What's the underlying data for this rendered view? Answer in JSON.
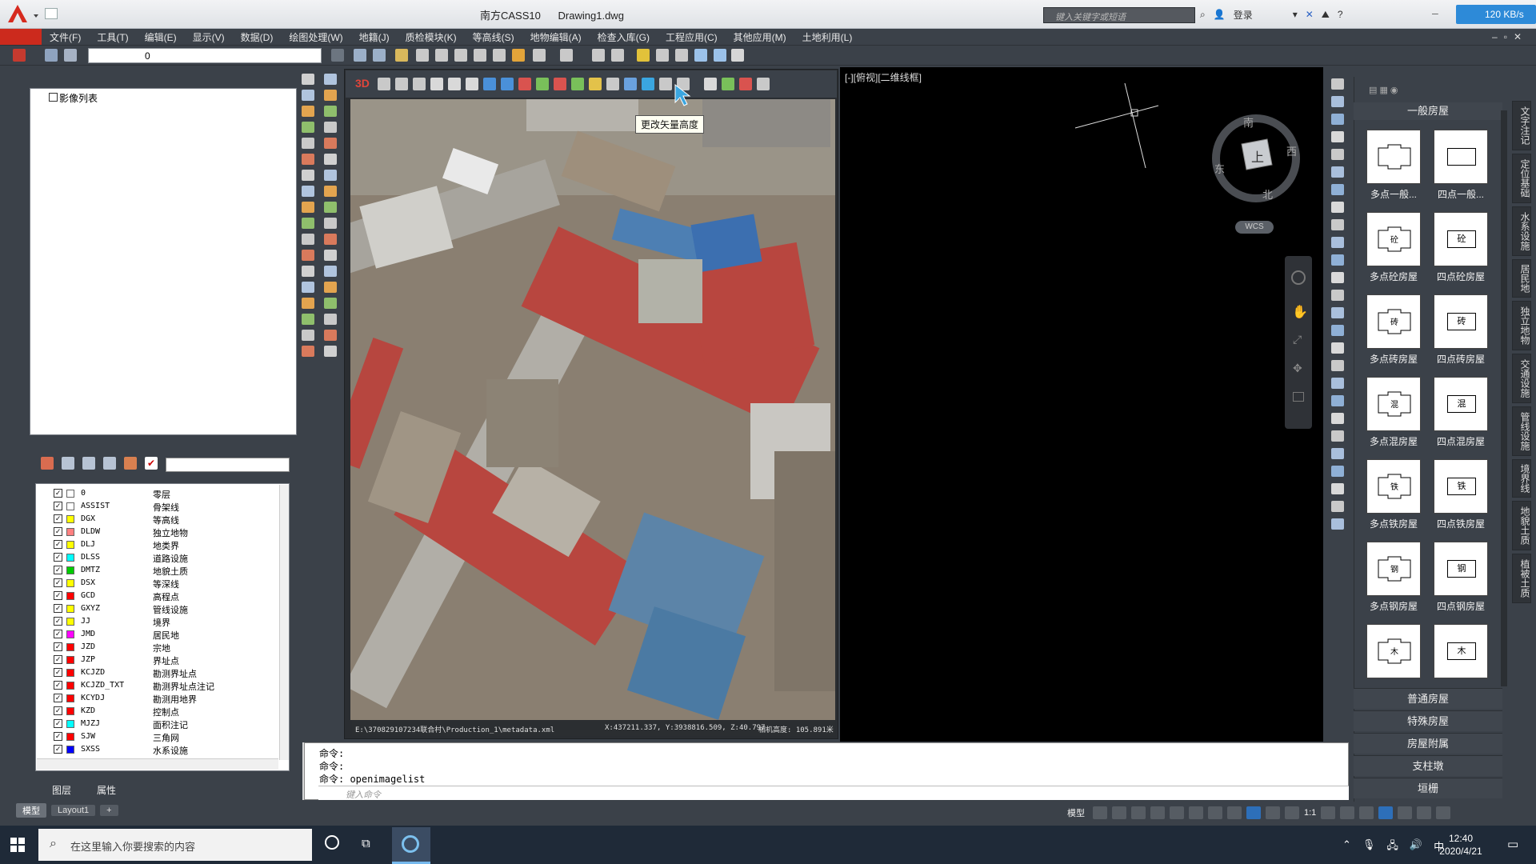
{
  "title": {
    "app": "南方CASS10",
    "file": "Drawing1.dwg"
  },
  "search": {
    "placeholder": "键入关键字或短语"
  },
  "login": "登录",
  "network": "120 KB/s",
  "menu": [
    "文件(F)",
    "工具(T)",
    "编辑(E)",
    "显示(V)",
    "数据(D)",
    "绘图处理(W)",
    "地籍(J)",
    "质检模块(K)",
    "等高线(S)",
    "地物编辑(A)",
    "检查入库(G)",
    "工程应用(C)",
    "其他应用(M)",
    "土地利用(L)"
  ],
  "layer_combo": "0",
  "image_list": {
    "label": "影像列表"
  },
  "layers": [
    {
      "code": "0",
      "desc": "零层",
      "color": "#ffffff"
    },
    {
      "code": "ASSIST",
      "desc": "骨架线",
      "color": "#ffffff"
    },
    {
      "code": "DGX",
      "desc": "等高线",
      "color": "#ffff00"
    },
    {
      "code": "DLDW",
      "desc": "独立地物",
      "color": "#ff8080"
    },
    {
      "code": "DLJ",
      "desc": "地类界",
      "color": "#ffff00"
    },
    {
      "code": "DLSS",
      "desc": "道路设施",
      "color": "#00ffff"
    },
    {
      "code": "DMTZ",
      "desc": "地貌土质",
      "color": "#00cc00"
    },
    {
      "code": "DSX",
      "desc": "等深线",
      "color": "#ffff00"
    },
    {
      "code": "GCD",
      "desc": "高程点",
      "color": "#ff0000"
    },
    {
      "code": "GXYZ",
      "desc": "管线设施",
      "color": "#ffff00"
    },
    {
      "code": "JJ",
      "desc": "境界",
      "color": "#ffff00"
    },
    {
      "code": "JMD",
      "desc": "居民地",
      "color": "#ff00ff"
    },
    {
      "code": "JZD",
      "desc": "宗地",
      "color": "#ff0000"
    },
    {
      "code": "JZP",
      "desc": "界址点",
      "color": "#ff0000"
    },
    {
      "code": "KCJZD",
      "desc": "勘测界址点",
      "color": "#ff0000"
    },
    {
      "code": "KCJZD_TXT",
      "desc": "勘测界址点注记",
      "color": "#ff0000"
    },
    {
      "code": "KCYDJ",
      "desc": "勘测用地界",
      "color": "#ff0000"
    },
    {
      "code": "KZD",
      "desc": "控制点",
      "color": "#ff0000"
    },
    {
      "code": "MJZJ",
      "desc": "面积注记",
      "color": "#00ffff"
    },
    {
      "code": "SJW",
      "desc": "三角网",
      "color": "#ff0000"
    },
    {
      "code": "SXSS",
      "desc": "水系设施",
      "color": "#0000ff"
    }
  ],
  "left_tabs": {
    "layers": "图层",
    "props": "属性"
  },
  "model_tabs": {
    "model": "模型",
    "layout": "Layout1",
    "add": "+"
  },
  "image_toolbar": {
    "label3d": "3D"
  },
  "tooltip": "更改矢量高度",
  "image_status": {
    "path": "E:\\370829107234联合村\\Production_1\\metadata.xml",
    "coords": "X:437211.337, Y:3938816.509, Z:40.797",
    "camera": "相机高度: 105.891米"
  },
  "view_label": "[-][俯视][二维线框]",
  "compass": {
    "north": "北",
    "south": "南",
    "east": "东",
    "west": "西",
    "center": "上"
  },
  "wcs": "WCS",
  "palette": {
    "header": "一般房屋",
    "items": [
      {
        "label": "多点一般...",
        "glyph": ""
      },
      {
        "label": "四点一般...",
        "glyph": ""
      },
      {
        "label": "多点砼房屋",
        "glyph": "砼"
      },
      {
        "label": "四点砼房屋",
        "glyph": "砼"
      },
      {
        "label": "多点砖房屋",
        "glyph": "砖"
      },
      {
        "label": "四点砖房屋",
        "glyph": "砖"
      },
      {
        "label": "多点混房屋",
        "glyph": "混"
      },
      {
        "label": "四点混房屋",
        "glyph": "混"
      },
      {
        "label": "多点铁房屋",
        "glyph": "铁"
      },
      {
        "label": "四点铁房屋",
        "glyph": "铁"
      },
      {
        "label": "多点钢房屋",
        "glyph": "钢"
      },
      {
        "label": "四点钢房屋",
        "glyph": "钢"
      },
      {
        "label": "",
        "glyph": "木"
      },
      {
        "label": "",
        "glyph": "木"
      }
    ],
    "sections": [
      "普通房屋",
      "特殊房屋",
      "房屋附属",
      "支柱墩",
      "垣栅"
    ]
  },
  "side_tabs": [
    "文字注记",
    "定位基础",
    "水系设施",
    "居民地",
    "独立地物",
    "交通设施",
    "管线设施",
    "境界线",
    "地貌土质",
    "植被土质"
  ],
  "command": {
    "lines": [
      "命令:",
      "命令:",
      "命令: openimagelist"
    ],
    "input_placeholder": "键入命令"
  },
  "status": {
    "model": "模型",
    "scale": "1:1"
  },
  "taskbar": {
    "search": "在这里输入你要搜索的内容",
    "time": "12:40",
    "date": "2020/4/21",
    "ime": "中"
  }
}
